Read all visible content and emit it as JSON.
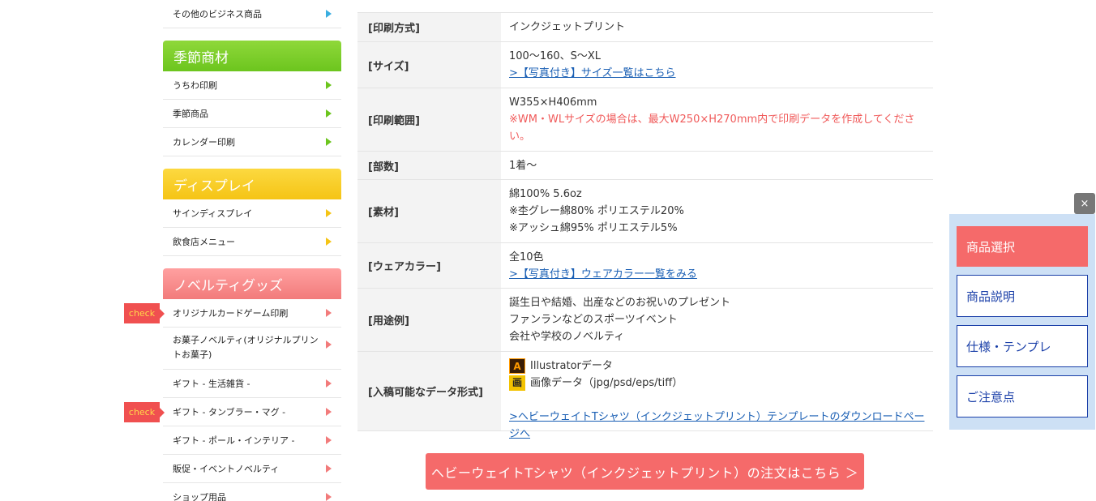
{
  "sidebar": {
    "top_item": "その他のビジネス商品",
    "seasonal": {
      "heading": "季節商材",
      "items": [
        "うちわ印刷",
        "季節商品",
        "カレンダー印刷"
      ]
    },
    "display": {
      "heading": "ディスプレイ",
      "items": [
        "サインディスプレイ",
        "飲食店メニュー"
      ]
    },
    "novelty": {
      "heading": "ノベルティグッズ",
      "items": [
        "オリジナルカードゲーム印刷",
        "お菓子ノベルティ(オリジナルプリントお菓子)",
        "ギフト - 生活雑貨 -",
        "ギフト - タンブラー・マグ -",
        "ギフト - ポール・インテリア -",
        "販促・イベントノベルティ",
        "ショップ用品"
      ],
      "check_label": "check"
    }
  },
  "spec": {
    "print_method": {
      "label": "[印刷方式]",
      "value": "インクジェットプリント"
    },
    "size": {
      "label": "[サイズ]",
      "value": "100〜160、S〜XL",
      "link": ">【写真付き】サイズ一覧はこちら"
    },
    "print_area": {
      "label": "[印刷範囲]",
      "value": "W355×H406mm",
      "note": "※WM・WLサイズの場合は、最大W250×H270mm内で印刷データを作成してください。"
    },
    "quantity": {
      "label": "[部数]",
      "value": "1着〜"
    },
    "material": {
      "label": "[素材]",
      "lines": [
        "綿100% 5.6oz",
        "※杢グレー綿80% ポリエステル20%",
        "※アッシュ綿95% ポリエステル5%"
      ]
    },
    "color": {
      "label": "[ウェアカラー]",
      "value": "全10色",
      "link": ">【写真付き】ウェアカラー一覧をみる"
    },
    "usage": {
      "label": "[用途例]",
      "lines": [
        "誕生日や結婚、出産などのお祝いのプレゼント",
        "ファンランなどのスポーツイベント",
        "会社や学校のノベルティ"
      ]
    },
    "formats": {
      "label": "[入稿可能なデータ形式]",
      "ai_icon": "A",
      "ai_text": "Illustratorデータ",
      "img_icon": "画",
      "img_text": "画像データ（jpg/psd/eps/tiff）",
      "link": ">ヘビーウェイトTシャツ（インクジェットプリント）テンプレートのダウンロードページへ"
    }
  },
  "order_button": "ヘビーウェイトTシャツ（インクジェットプリント）の注文はこちら ＞",
  "float_nav": {
    "close": "×",
    "items": [
      "商品選択",
      "商品説明",
      "仕様・テンプレ",
      "ご注意点"
    ]
  },
  "colors": {
    "accent_red": "#f56a6a",
    "nav_blue": "#1a3fa8",
    "link_blue": "#1a5fb4"
  }
}
